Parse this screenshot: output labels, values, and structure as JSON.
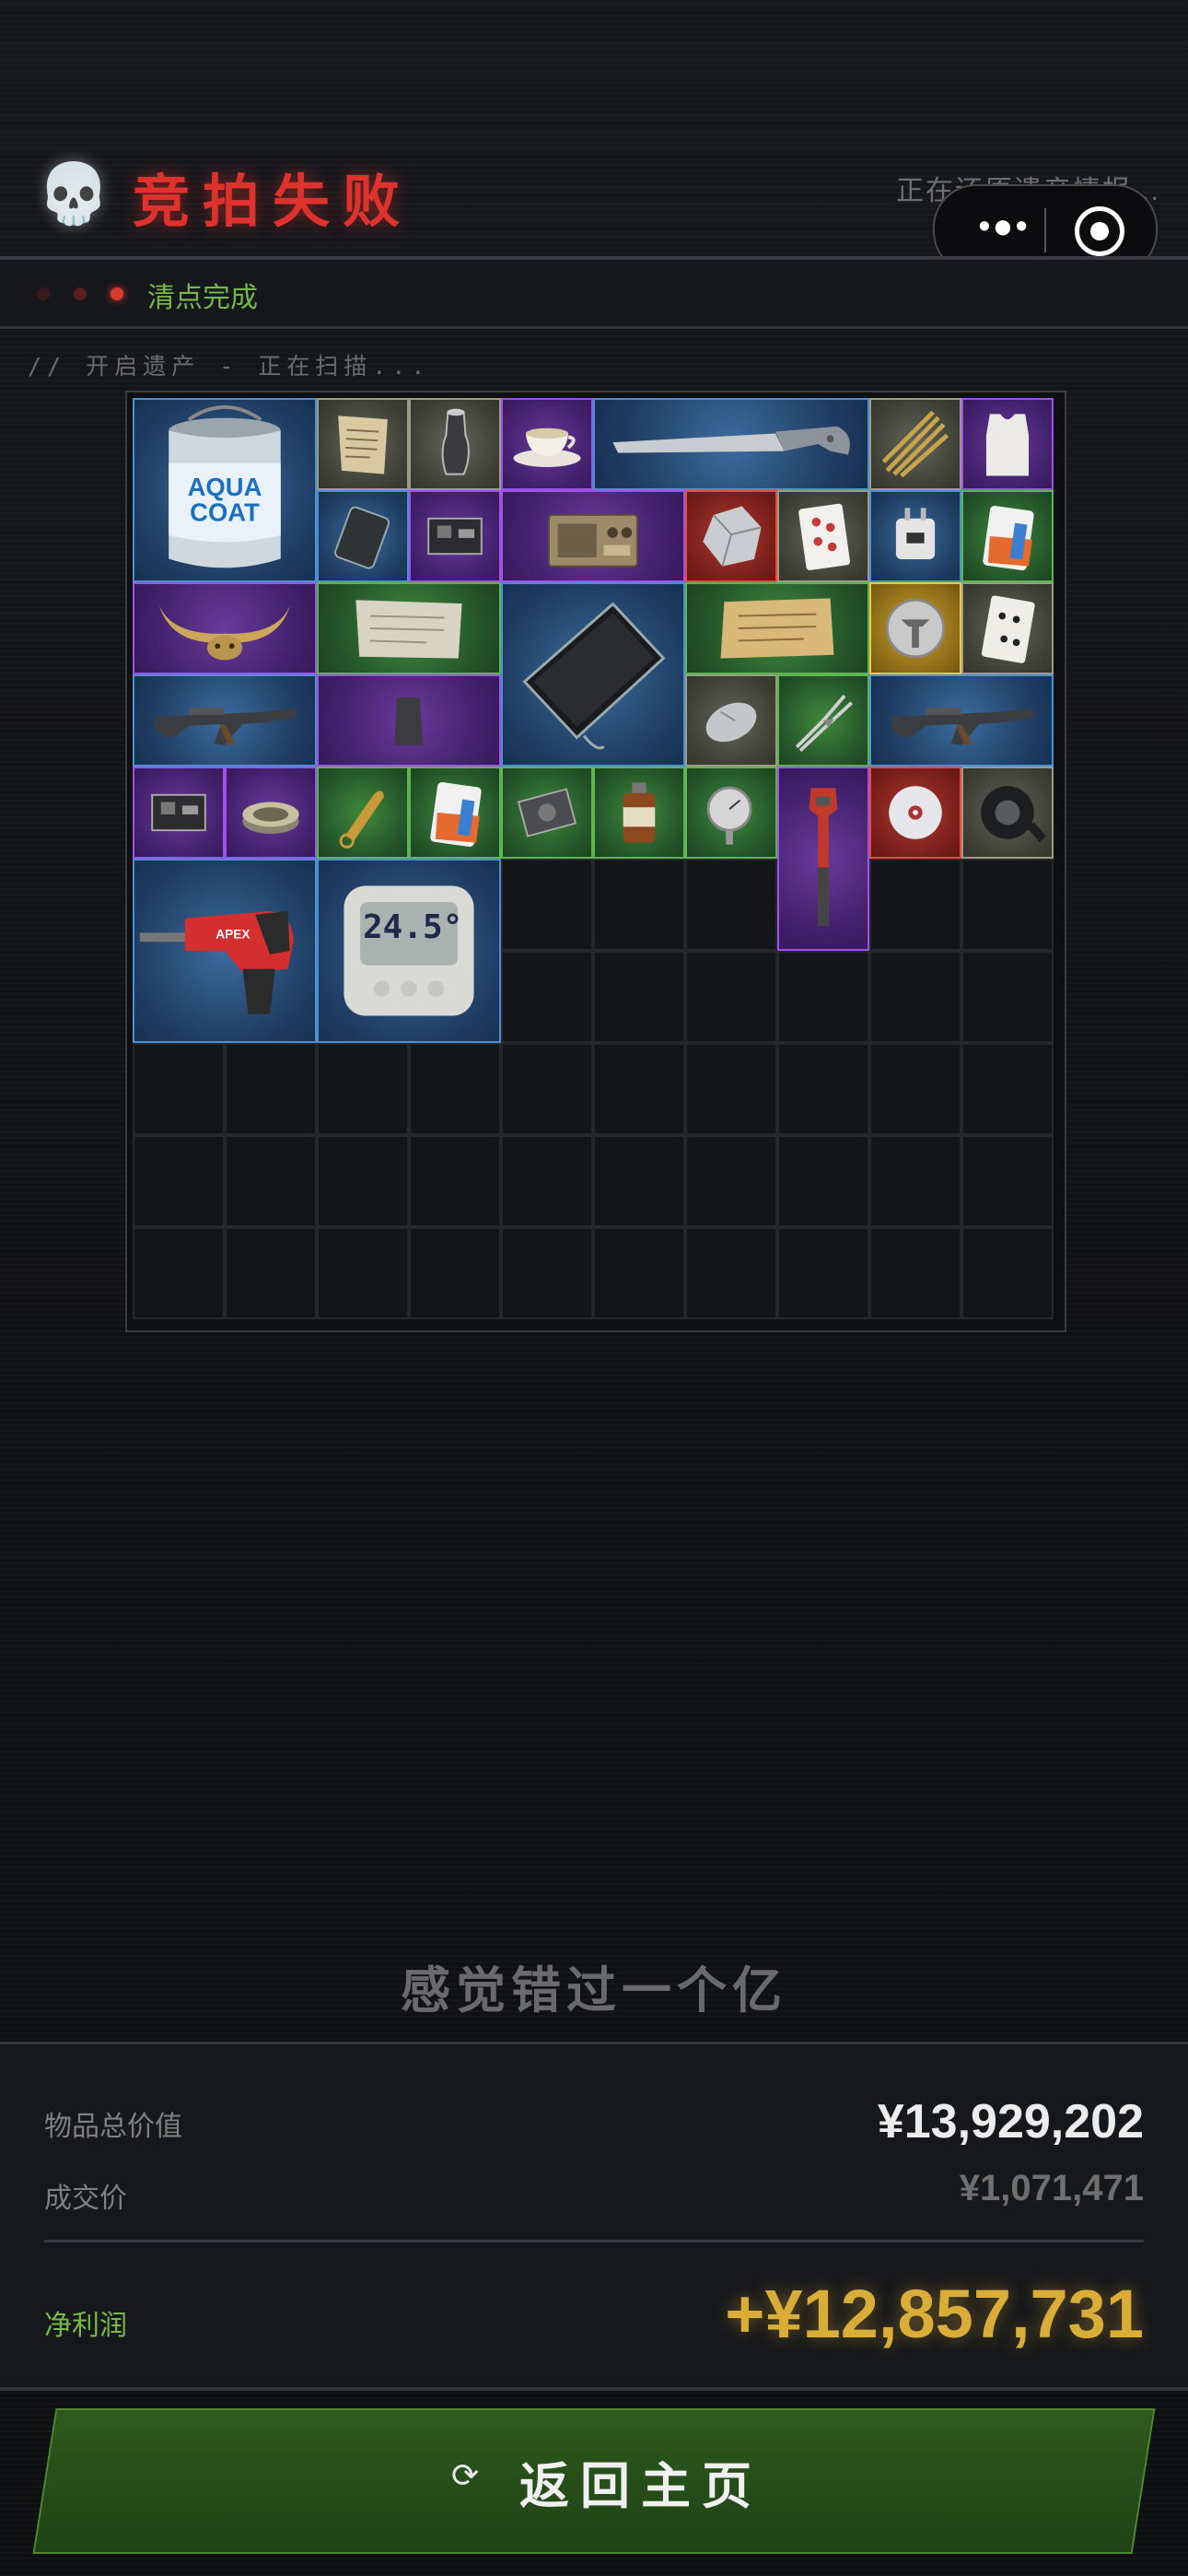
{
  "header": {
    "title": "竞拍失败",
    "restoring_text": "正在还原遗产情报...",
    "capsule_more_icon": "more-dots-icon",
    "capsule_close_icon": "target-circle-icon"
  },
  "status": {
    "text": "清点完成",
    "dot_colors": [
      "#3a1a1a",
      "#5a1e1c",
      "#d8392f"
    ]
  },
  "scan_text": "// 开启遗产 - 正在扫描...",
  "inventory": {
    "columns": 10,
    "rows": 10,
    "items": [
      {
        "name": "paint-can",
        "rarity": "blue",
        "label": "AQUA COAT"
      },
      {
        "name": "paper-note",
        "rarity": "gray"
      },
      {
        "name": "pepper-grinder",
        "rarity": "gray"
      },
      {
        "name": "teacup",
        "rarity": "purple"
      },
      {
        "name": "saw-knife",
        "rarity": "blue"
      },
      {
        "name": "rope",
        "rarity": "gray"
      },
      {
        "name": "tank-top",
        "rarity": "purple"
      },
      {
        "name": "power-bank",
        "rarity": "blue"
      },
      {
        "name": "circuit-board",
        "rarity": "purple"
      },
      {
        "name": "radio",
        "rarity": "purple"
      },
      {
        "name": "crystal-rock",
        "rarity": "red"
      },
      {
        "name": "playing-card",
        "rarity": "gray"
      },
      {
        "name": "power-adapter",
        "rarity": "blue"
      },
      {
        "name": "battery",
        "rarity": "green"
      },
      {
        "name": "horned-mask",
        "rarity": "purple"
      },
      {
        "name": "old-paper",
        "rarity": "green"
      },
      {
        "name": "tablet",
        "rarity": "blue"
      },
      {
        "name": "parchment",
        "rarity": "green"
      },
      {
        "name": "gold-medallion",
        "rarity": "gold"
      },
      {
        "name": "playing-card",
        "rarity": "gray"
      },
      {
        "name": "rifle",
        "rarity": "blue"
      },
      {
        "name": "soap-bar",
        "rarity": "purple"
      },
      {
        "name": "computer-mouse",
        "rarity": "gray"
      },
      {
        "name": "pliers",
        "rarity": "green"
      },
      {
        "name": "rifle",
        "rarity": "blue"
      },
      {
        "name": "circuit-board",
        "rarity": "purple"
      },
      {
        "name": "tin-can",
        "rarity": "purple"
      },
      {
        "name": "bullet",
        "rarity": "green"
      },
      {
        "name": "battery",
        "rarity": "green"
      },
      {
        "name": "hard-drive",
        "rarity": "green"
      },
      {
        "name": "medicine-bottle",
        "rarity": "green"
      },
      {
        "name": "pressure-gauge",
        "rarity": "green"
      },
      {
        "name": "pipe-wrench",
        "rarity": "purple"
      },
      {
        "name": "disc",
        "rarity": "red"
      },
      {
        "name": "duct-tape",
        "rarity": "gray"
      },
      {
        "name": "hammer-drill",
        "rarity": "blue",
        "label": "APEX"
      },
      {
        "name": "thermometer",
        "rarity": "blue",
        "label": "24.5°"
      }
    ]
  },
  "quote": "感觉错过一个亿",
  "summary": {
    "total_label": "物品总价值",
    "total_value": "¥13,929,202",
    "deal_label": "成交价",
    "deal_value": "¥1,071,471",
    "profit_label": "净利润",
    "profit_value": "+¥12,857,731"
  },
  "button": {
    "icon": "refresh-icon",
    "label": "返回主页"
  },
  "colors": {
    "title_red": "#e0322c",
    "status_green": "#77b84a",
    "profit_gold": "#d9ad38",
    "button_green": "#2a521a"
  }
}
